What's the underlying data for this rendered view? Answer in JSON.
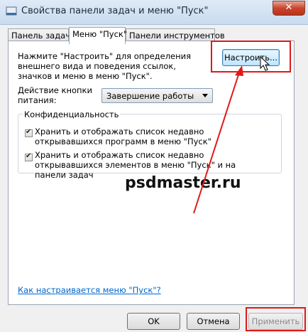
{
  "window": {
    "title": "Свойства панели задач и меню \"Пуск\"",
    "close_label": "✕"
  },
  "tabs": [
    {
      "label": "Панель задач"
    },
    {
      "label": "Меню \"Пуск\""
    },
    {
      "label": "Панели инструментов"
    }
  ],
  "start_menu": {
    "description": "Нажмите \"Настроить\" для определения внешнего вида и поведения ссылок, значков и меню в меню \"Пуск\".",
    "customize_label": "Настроить...",
    "power_label": "Действие кнопки питания:",
    "power_value": "Завершение работы",
    "privacy_label": "Конфиденциальность",
    "privacy_options": [
      {
        "label": "Хранить и отображать список недавно открывавшихся программ в меню \"Пуск\"",
        "checked": true
      },
      {
        "label": "Хранить и отображать список недавно открывавшихся элементов в меню \"Пуск\" и на панели задач",
        "checked": true
      }
    ],
    "help_link": "Как настраивается меню \"Пуск\"?"
  },
  "watermark": "psdmaster.ru",
  "buttons": {
    "ok": "OK",
    "cancel": "Отмена",
    "apply": "Применить"
  },
  "colors": {
    "annotation": "#e01919",
    "link": "#0066cc"
  }
}
